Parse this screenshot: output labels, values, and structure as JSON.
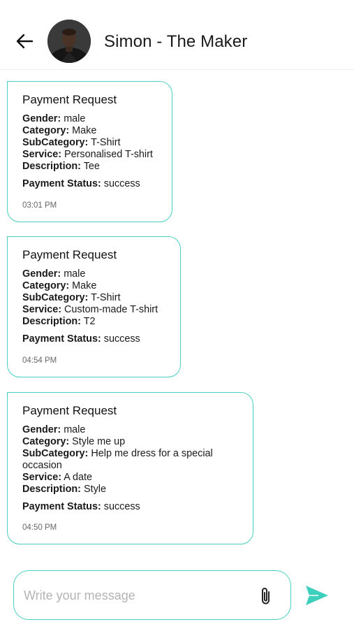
{
  "header": {
    "title": "Simon - The Maker"
  },
  "messages": [
    {
      "title": "Payment Request",
      "gender_label": "Gender:",
      "gender": "male",
      "category_label": "Category:",
      "category": "Make",
      "subcategory_label": "SubCategory:",
      "subcategory": "T-Shirt",
      "service_label": "Service:",
      "service": "Personalised T-shirt",
      "description_label": "Description:",
      "description": "Tee",
      "status_label": "Payment Status:",
      "status": "success",
      "time": "03:01 PM"
    },
    {
      "title": "Payment Request",
      "gender_label": "Gender:",
      "gender": "male",
      "category_label": "Category:",
      "category": "Make",
      "subcategory_label": "SubCategory:",
      "subcategory": "T-Shirt",
      "service_label": "Service:",
      "service": "Custom-made T-shirt",
      "description_label": "Description:",
      "description": "T2",
      "status_label": "Payment Status:",
      "status": "success",
      "time": "04:54 PM"
    },
    {
      "title": "Payment Request",
      "gender_label": "Gender:",
      "gender": "male",
      "category_label": "Category:",
      "category": "Style me up",
      "subcategory_label": "SubCategory:",
      "subcategory": "Help me dress for a special occasion",
      "service_label": "Service:",
      "service": "A date",
      "description_label": "Description:",
      "description": "Style",
      "status_label": "Payment Status:",
      "status": "success",
      "time": "04:50 PM"
    }
  ],
  "composer": {
    "placeholder": "Write your message",
    "value": ""
  },
  "icons": {
    "back": "arrow-left-icon",
    "attach": "paperclip-icon",
    "send": "send-icon"
  },
  "colors": {
    "accent": "#49cfc1",
    "send": "#3ecfbd"
  }
}
